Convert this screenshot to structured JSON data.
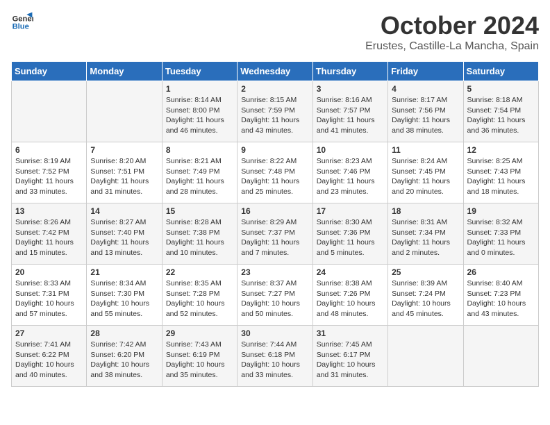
{
  "logo": {
    "line1": "General",
    "line2": "Blue"
  },
  "title": "October 2024",
  "location": "Erustes, Castille-La Mancha, Spain",
  "days_of_week": [
    "Sunday",
    "Monday",
    "Tuesday",
    "Wednesday",
    "Thursday",
    "Friday",
    "Saturday"
  ],
  "weeks": [
    [
      {
        "day": "",
        "info": ""
      },
      {
        "day": "",
        "info": ""
      },
      {
        "day": "1",
        "info": "Sunrise: 8:14 AM\nSunset: 8:00 PM\nDaylight: 11 hours\nand 46 minutes."
      },
      {
        "day": "2",
        "info": "Sunrise: 8:15 AM\nSunset: 7:59 PM\nDaylight: 11 hours\nand 43 minutes."
      },
      {
        "day": "3",
        "info": "Sunrise: 8:16 AM\nSunset: 7:57 PM\nDaylight: 11 hours\nand 41 minutes."
      },
      {
        "day": "4",
        "info": "Sunrise: 8:17 AM\nSunset: 7:56 PM\nDaylight: 11 hours\nand 38 minutes."
      },
      {
        "day": "5",
        "info": "Sunrise: 8:18 AM\nSunset: 7:54 PM\nDaylight: 11 hours\nand 36 minutes."
      }
    ],
    [
      {
        "day": "6",
        "info": "Sunrise: 8:19 AM\nSunset: 7:52 PM\nDaylight: 11 hours\nand 33 minutes."
      },
      {
        "day": "7",
        "info": "Sunrise: 8:20 AM\nSunset: 7:51 PM\nDaylight: 11 hours\nand 31 minutes."
      },
      {
        "day": "8",
        "info": "Sunrise: 8:21 AM\nSunset: 7:49 PM\nDaylight: 11 hours\nand 28 minutes."
      },
      {
        "day": "9",
        "info": "Sunrise: 8:22 AM\nSunset: 7:48 PM\nDaylight: 11 hours\nand 25 minutes."
      },
      {
        "day": "10",
        "info": "Sunrise: 8:23 AM\nSunset: 7:46 PM\nDaylight: 11 hours\nand 23 minutes."
      },
      {
        "day": "11",
        "info": "Sunrise: 8:24 AM\nSunset: 7:45 PM\nDaylight: 11 hours\nand 20 minutes."
      },
      {
        "day": "12",
        "info": "Sunrise: 8:25 AM\nSunset: 7:43 PM\nDaylight: 11 hours\nand 18 minutes."
      }
    ],
    [
      {
        "day": "13",
        "info": "Sunrise: 8:26 AM\nSunset: 7:42 PM\nDaylight: 11 hours\nand 15 minutes."
      },
      {
        "day": "14",
        "info": "Sunrise: 8:27 AM\nSunset: 7:40 PM\nDaylight: 11 hours\nand 13 minutes."
      },
      {
        "day": "15",
        "info": "Sunrise: 8:28 AM\nSunset: 7:38 PM\nDaylight: 11 hours\nand 10 minutes."
      },
      {
        "day": "16",
        "info": "Sunrise: 8:29 AM\nSunset: 7:37 PM\nDaylight: 11 hours\nand 7 minutes."
      },
      {
        "day": "17",
        "info": "Sunrise: 8:30 AM\nSunset: 7:36 PM\nDaylight: 11 hours\nand 5 minutes."
      },
      {
        "day": "18",
        "info": "Sunrise: 8:31 AM\nSunset: 7:34 PM\nDaylight: 11 hours\nand 2 minutes."
      },
      {
        "day": "19",
        "info": "Sunrise: 8:32 AM\nSunset: 7:33 PM\nDaylight: 11 hours\nand 0 minutes."
      }
    ],
    [
      {
        "day": "20",
        "info": "Sunrise: 8:33 AM\nSunset: 7:31 PM\nDaylight: 10 hours\nand 57 minutes."
      },
      {
        "day": "21",
        "info": "Sunrise: 8:34 AM\nSunset: 7:30 PM\nDaylight: 10 hours\nand 55 minutes."
      },
      {
        "day": "22",
        "info": "Sunrise: 8:35 AM\nSunset: 7:28 PM\nDaylight: 10 hours\nand 52 minutes."
      },
      {
        "day": "23",
        "info": "Sunrise: 8:37 AM\nSunset: 7:27 PM\nDaylight: 10 hours\nand 50 minutes."
      },
      {
        "day": "24",
        "info": "Sunrise: 8:38 AM\nSunset: 7:26 PM\nDaylight: 10 hours\nand 48 minutes."
      },
      {
        "day": "25",
        "info": "Sunrise: 8:39 AM\nSunset: 7:24 PM\nDaylight: 10 hours\nand 45 minutes."
      },
      {
        "day": "26",
        "info": "Sunrise: 8:40 AM\nSunset: 7:23 PM\nDaylight: 10 hours\nand 43 minutes."
      }
    ],
    [
      {
        "day": "27",
        "info": "Sunrise: 7:41 AM\nSunset: 6:22 PM\nDaylight: 10 hours\nand 40 minutes."
      },
      {
        "day": "28",
        "info": "Sunrise: 7:42 AM\nSunset: 6:20 PM\nDaylight: 10 hours\nand 38 minutes."
      },
      {
        "day": "29",
        "info": "Sunrise: 7:43 AM\nSunset: 6:19 PM\nDaylight: 10 hours\nand 35 minutes."
      },
      {
        "day": "30",
        "info": "Sunrise: 7:44 AM\nSunset: 6:18 PM\nDaylight: 10 hours\nand 33 minutes."
      },
      {
        "day": "31",
        "info": "Sunrise: 7:45 AM\nSunset: 6:17 PM\nDaylight: 10 hours\nand 31 minutes."
      },
      {
        "day": "",
        "info": ""
      },
      {
        "day": "",
        "info": ""
      }
    ]
  ]
}
